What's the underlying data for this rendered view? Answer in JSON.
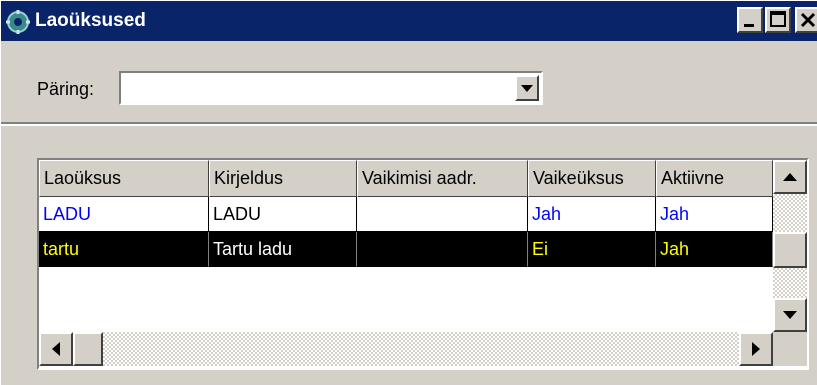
{
  "window": {
    "title": "Laoüksused",
    "app_icon": "gear-icon",
    "controls": [
      "minimize-icon",
      "maximize-icon",
      "close-icon"
    ]
  },
  "query": {
    "label": "Päring:",
    "value": ""
  },
  "grid": {
    "columns": [
      "Laoüksus",
      "Kirjeldus",
      "Vaikimisi aadr.",
      "Vaikeüksus",
      "Aktiivne"
    ],
    "rows": [
      [
        "LADU",
        "LADU",
        "",
        "Jah",
        "Jah"
      ],
      [
        "tartu",
        "Tartu ladu",
        "",
        "Ei",
        "Jah"
      ]
    ],
    "selected_row": 1
  },
  "colors": {
    "titlebar": "#0a246a",
    "link_blue": "#0000ff",
    "selected_bg": "#000000",
    "selected_text": "#ffff00"
  }
}
